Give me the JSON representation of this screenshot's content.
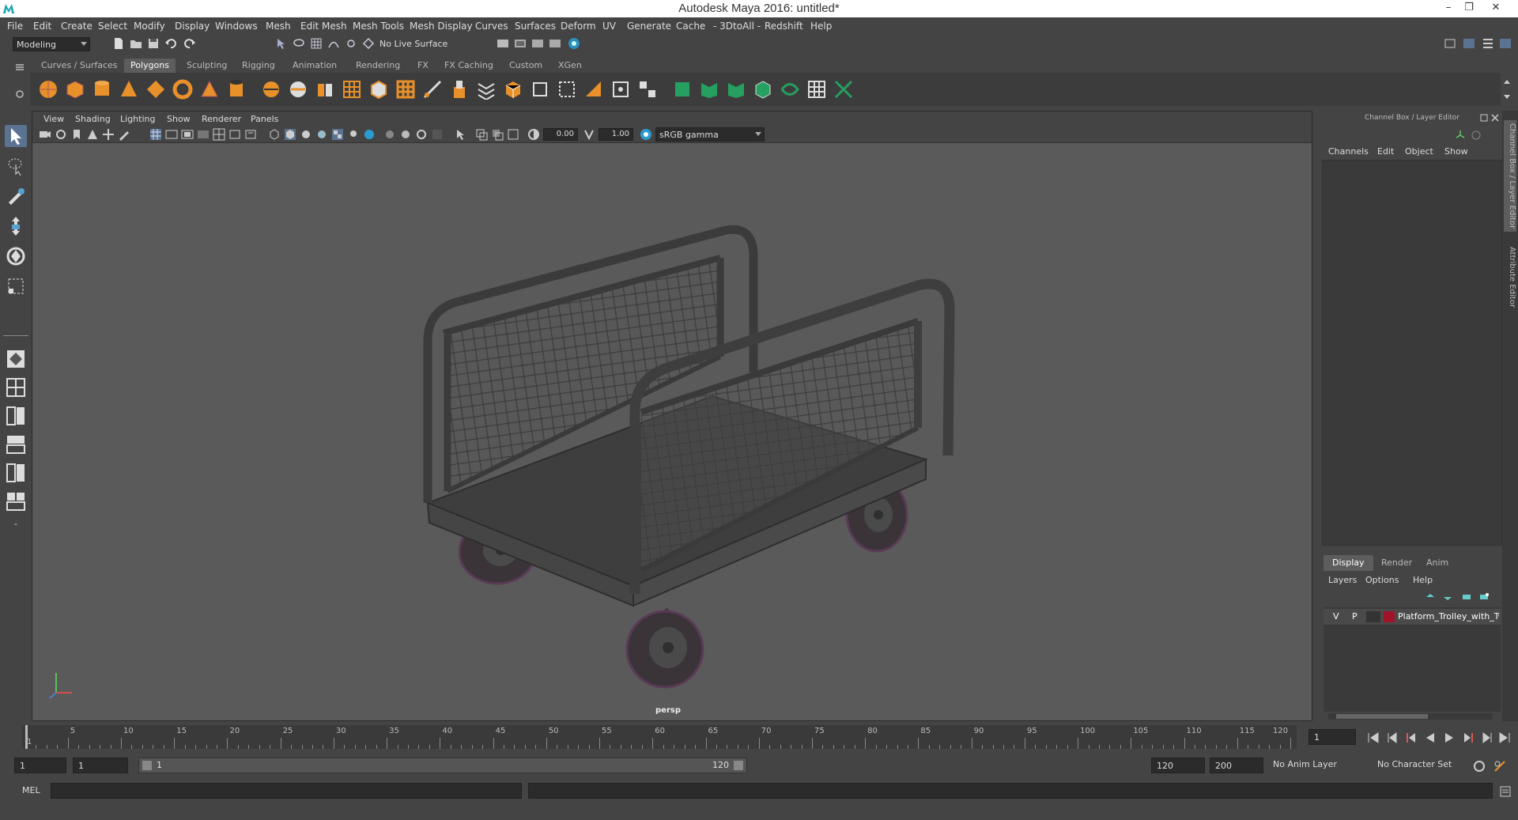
{
  "window": {
    "title": "Autodesk Maya 2016: untitled*",
    "minimize": "–",
    "restore": "❐",
    "close": "✕"
  },
  "menubar": [
    "File",
    "Edit",
    "Create",
    "Select",
    "Modify",
    "Display",
    "Windows",
    "Mesh",
    "Edit Mesh",
    "Mesh Tools",
    "Mesh Display",
    "Curves",
    "Surfaces",
    "Deform",
    "UV",
    "Generate",
    "Cache",
    "- 3DtoAll -",
    "Redshift",
    "Help"
  ],
  "statusline": {
    "mode": "Modeling",
    "live_surface": "No Live Surface"
  },
  "shelf_tabs": [
    "Curves / Surfaces",
    "Polygons",
    "Sculpting",
    "Rigging",
    "Animation",
    "Rendering",
    "FX",
    "FX Caching",
    "Custom",
    "XGen"
  ],
  "active_shelf_tab": "Polygons",
  "viewport": {
    "menus": [
      "View",
      "Shading",
      "Lighting",
      "Show",
      "Renderer",
      "Panels"
    ],
    "exposure": "0.00",
    "gamma": "1.00",
    "color_space": "sRGB gamma",
    "camera_label": "persp"
  },
  "channelbox": {
    "title": "Channel Box / Layer Editor",
    "menus": [
      "Channels",
      "Edit",
      "Object",
      "Show"
    ],
    "layer_tabs": [
      "Display",
      "Render",
      "Anim"
    ],
    "active_layer_tab": "Display",
    "layer_menus": [
      "Layers",
      "Options",
      "Help"
    ],
    "layer": {
      "visible": "V",
      "playback": "P",
      "name": "Platform_Trolley_with_Tw",
      "color": "#a0142a"
    },
    "side_tabs": [
      "Channel Box / Layer Editor",
      "Attribute Editor"
    ]
  },
  "timeline": {
    "labels": [
      "1",
      "5",
      "10",
      "15",
      "20",
      "25",
      "30",
      "35",
      "40",
      "45",
      "50",
      "55",
      "60",
      "65",
      "70",
      "75",
      "80",
      "85",
      "90",
      "95",
      "100",
      "105",
      "110",
      "115",
      "120"
    ],
    "current_frame": "1"
  },
  "range": {
    "start": "1",
    "playback_start": "1",
    "range_start": "1",
    "range_end": "120",
    "playback_end": "120",
    "end": "200",
    "anim_layer": "No Anim Layer",
    "character_set": "No Character Set"
  },
  "cmdline": {
    "lang": "MEL"
  }
}
